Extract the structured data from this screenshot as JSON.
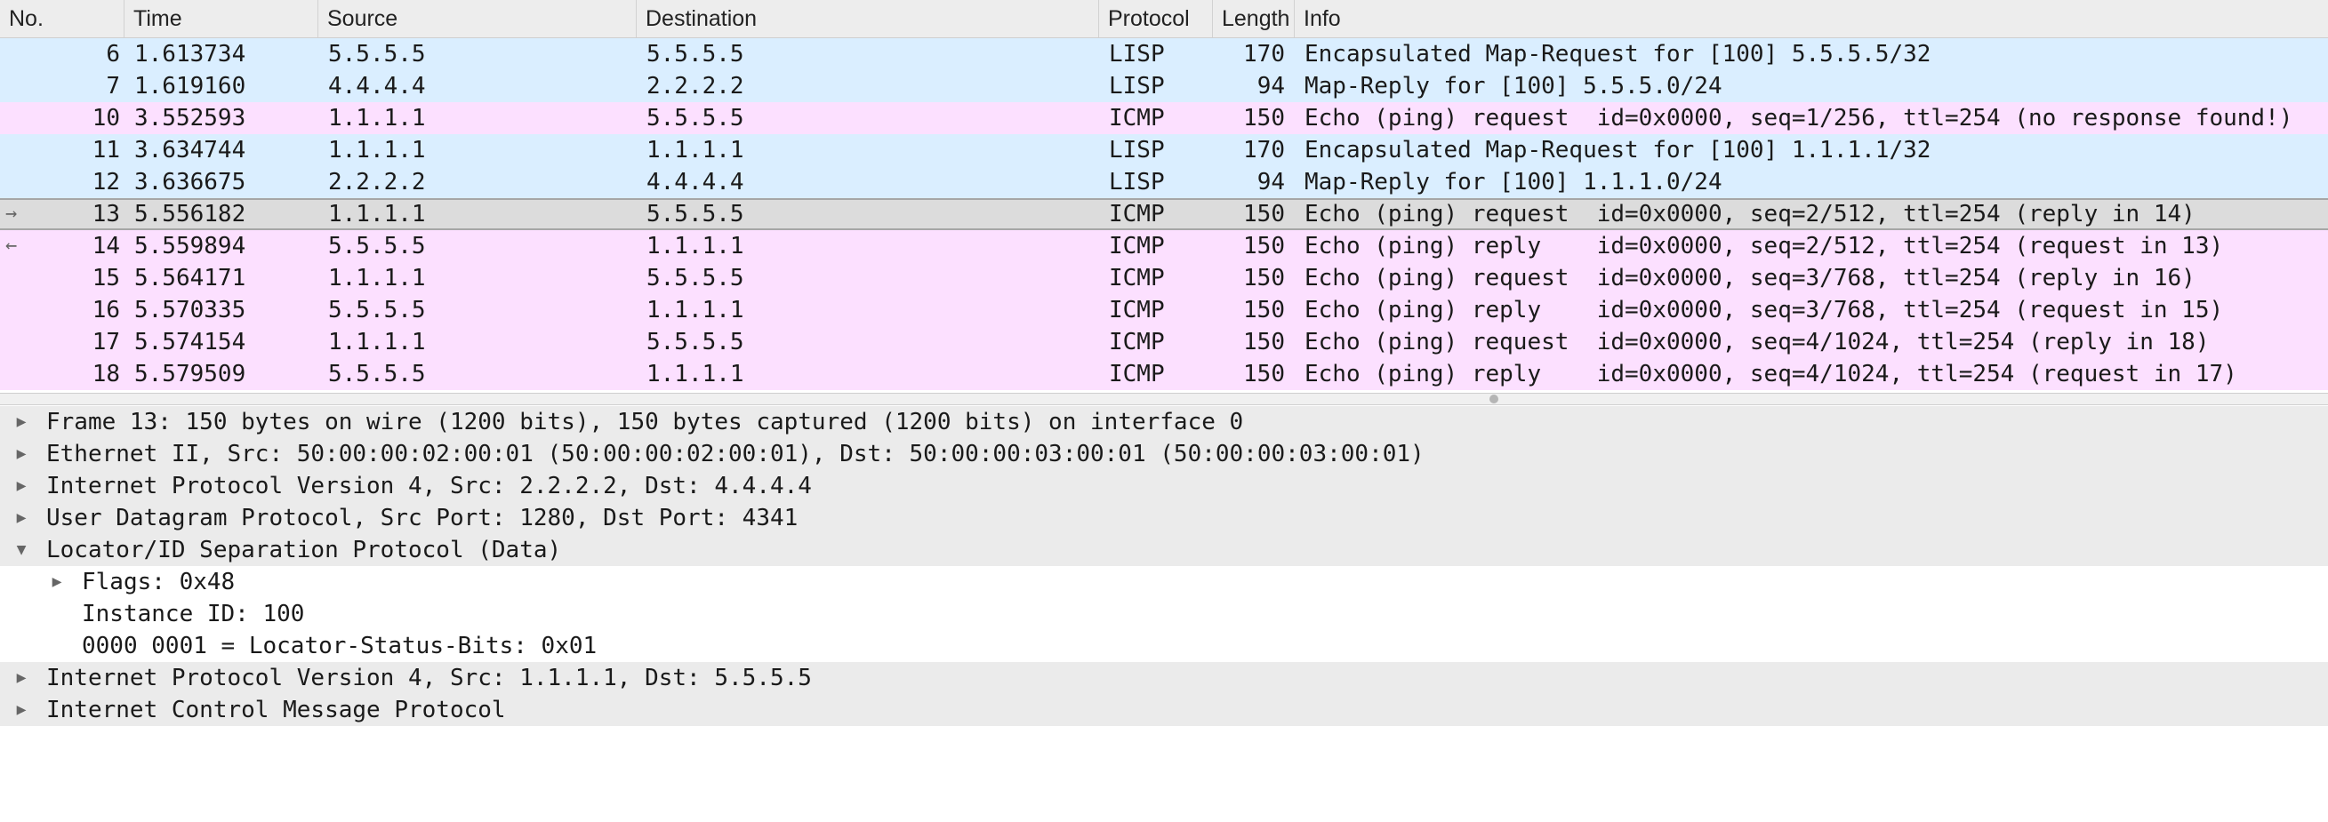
{
  "columns": {
    "no": "No.",
    "time": "Time",
    "source": "Source",
    "destination": "Destination",
    "protocol": "Protocol",
    "length": "Length",
    "info": "Info"
  },
  "packets": [
    {
      "no": "6",
      "time": "1.613734",
      "src": "5.5.5.5",
      "dst": "5.5.5.5",
      "proto": "LISP",
      "len": "170",
      "info": "Encapsulated Map-Request for [100] 5.5.5.5/32"
    },
    {
      "no": "7",
      "time": "1.619160",
      "src": "4.4.4.4",
      "dst": "2.2.2.2",
      "proto": "LISP",
      "len": "94",
      "info": "Map-Reply for [100] 5.5.5.0/24"
    },
    {
      "no": "10",
      "time": "3.552593",
      "src": "1.1.1.1",
      "dst": "5.5.5.5",
      "proto": "ICMP",
      "len": "150",
      "info": "Echo (ping) request  id=0x0000, seq=1/256, ttl=254 (no response found!)"
    },
    {
      "no": "11",
      "time": "3.634744",
      "src": "1.1.1.1",
      "dst": "1.1.1.1",
      "proto": "LISP",
      "len": "170",
      "info": "Encapsulated Map-Request for [100] 1.1.1.1/32"
    },
    {
      "no": "12",
      "time": "3.636675",
      "src": "2.2.2.2",
      "dst": "4.4.4.4",
      "proto": "LISP",
      "len": "94",
      "info": "Map-Reply for [100] 1.1.1.0/24"
    },
    {
      "no": "13",
      "time": "5.556182",
      "src": "1.1.1.1",
      "dst": "5.5.5.5",
      "proto": "ICMP",
      "len": "150",
      "info": "Echo (ping) request  id=0x0000, seq=2/512, ttl=254 (reply in 14)"
    },
    {
      "no": "14",
      "time": "5.559894",
      "src": "5.5.5.5",
      "dst": "1.1.1.1",
      "proto": "ICMP",
      "len": "150",
      "info": "Echo (ping) reply    id=0x0000, seq=2/512, ttl=254 (request in 13)"
    },
    {
      "no": "15",
      "time": "5.564171",
      "src": "1.1.1.1",
      "dst": "5.5.5.5",
      "proto": "ICMP",
      "len": "150",
      "info": "Echo (ping) request  id=0x0000, seq=3/768, ttl=254 (reply in 16)"
    },
    {
      "no": "16",
      "time": "5.570335",
      "src": "5.5.5.5",
      "dst": "1.1.1.1",
      "proto": "ICMP",
      "len": "150",
      "info": "Echo (ping) reply    id=0x0000, seq=3/768, ttl=254 (request in 15)"
    },
    {
      "no": "17",
      "time": "5.574154",
      "src": "1.1.1.1",
      "dst": "5.5.5.5",
      "proto": "ICMP",
      "len": "150",
      "info": "Echo (ping) request  id=0x0000, seq=4/1024, ttl=254 (reply in 18)"
    },
    {
      "no": "18",
      "time": "5.579509",
      "src": "5.5.5.5",
      "dst": "1.1.1.1",
      "proto": "ICMP",
      "len": "150",
      "info": "Echo (ping) reply    id=0x0000, seq=4/1024, ttl=254 (request in 17)"
    }
  ],
  "details": [
    "Frame 13: 150 bytes on wire (1200 bits), 150 bytes captured (1200 bits) on interface 0",
    "Ethernet II, Src: 50:00:00:02:00:01 (50:00:00:02:00:01), Dst: 50:00:00:03:00:01 (50:00:00:03:00:01)",
    "Internet Protocol Version 4, Src: 2.2.2.2, Dst: 4.4.4.4",
    "User Datagram Protocol, Src Port: 1280, Dst Port: 4341",
    "Locator/ID Separation Protocol (Data)",
    "Flags: 0x48",
    "Instance ID: 100",
    "0000 0001 = Locator-Status-Bits: 0x01",
    "Internet Protocol Version 4, Src: 1.1.1.1, Dst: 5.5.5.5",
    "Internet Control Message Protocol"
  ],
  "colors": {
    "lisp_row": "#daeeff",
    "icmp_row": "#fce0ff",
    "selected_row": "#dcdcdc"
  },
  "icons": {
    "request_arrow": "right-arrow-icon",
    "response_arrow": "left-arrow-icon",
    "collapsed": "triangle-right-icon",
    "expanded": "triangle-down-icon"
  }
}
